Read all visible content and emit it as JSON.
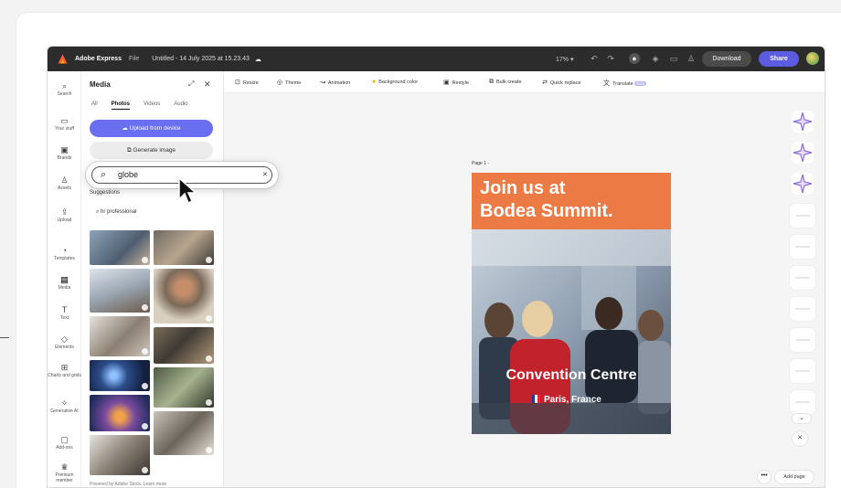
{
  "app": {
    "name": "Adobe Express",
    "menu": "File",
    "doc_title": "Untitled - 14 July 2025 at 15.23.43",
    "zoom": "17%",
    "download": "Download",
    "share": "Share"
  },
  "rail": [
    {
      "label": "Search",
      "icon": "search-icon"
    },
    {
      "label": "Your stuff",
      "icon": "folder-icon"
    },
    {
      "label": "Brands",
      "icon": "brand-icon"
    },
    {
      "label": "Assets",
      "icon": "people-icon"
    },
    {
      "label": "Upload",
      "icon": "upload-icon"
    },
    {
      "label": "Templates",
      "icon": "templates-icon"
    },
    {
      "label": "Media",
      "icon": "media-icon"
    },
    {
      "label": "Text",
      "icon": "text-icon"
    },
    {
      "label": "Elements",
      "icon": "shapes-icon"
    },
    {
      "label": "Charts and grids",
      "icon": "grid-icon"
    },
    {
      "label": "Generative AI",
      "icon": "sparkle-icon"
    },
    {
      "label": "Add-ons",
      "icon": "addons-icon"
    },
    {
      "label": "Premium member",
      "icon": "crown-icon"
    }
  ],
  "panel": {
    "title": "Media",
    "tabs": [
      "All",
      "Photos",
      "Videos",
      "Audio"
    ],
    "active_tab": "Photos",
    "upload": "Upload from device",
    "generate": "Generate image",
    "search_value": "globe",
    "suggestions_label": "Suggestions",
    "suggestion": "hr professional",
    "powered": "Powered by Adobe Stock. Learn more"
  },
  "toolbar": [
    "Resize",
    "Theme",
    "Animation",
    "Background color",
    "Restyle",
    "Bulk create",
    "Quick replace",
    "Translate"
  ],
  "toolbar_new": "New",
  "canvas": {
    "page_label": "Page 1 -",
    "headline_1": "Join us at",
    "headline_2": "Bodea Summit.",
    "venue": "Convention Centre",
    "city": "Paris, France"
  },
  "footer": {
    "add_page": "Add page",
    "more": "•••"
  },
  "colors": {
    "accent": "#5c5ce0",
    "poster_top": "#ec7a45",
    "topbar": "#2c2c2c"
  }
}
